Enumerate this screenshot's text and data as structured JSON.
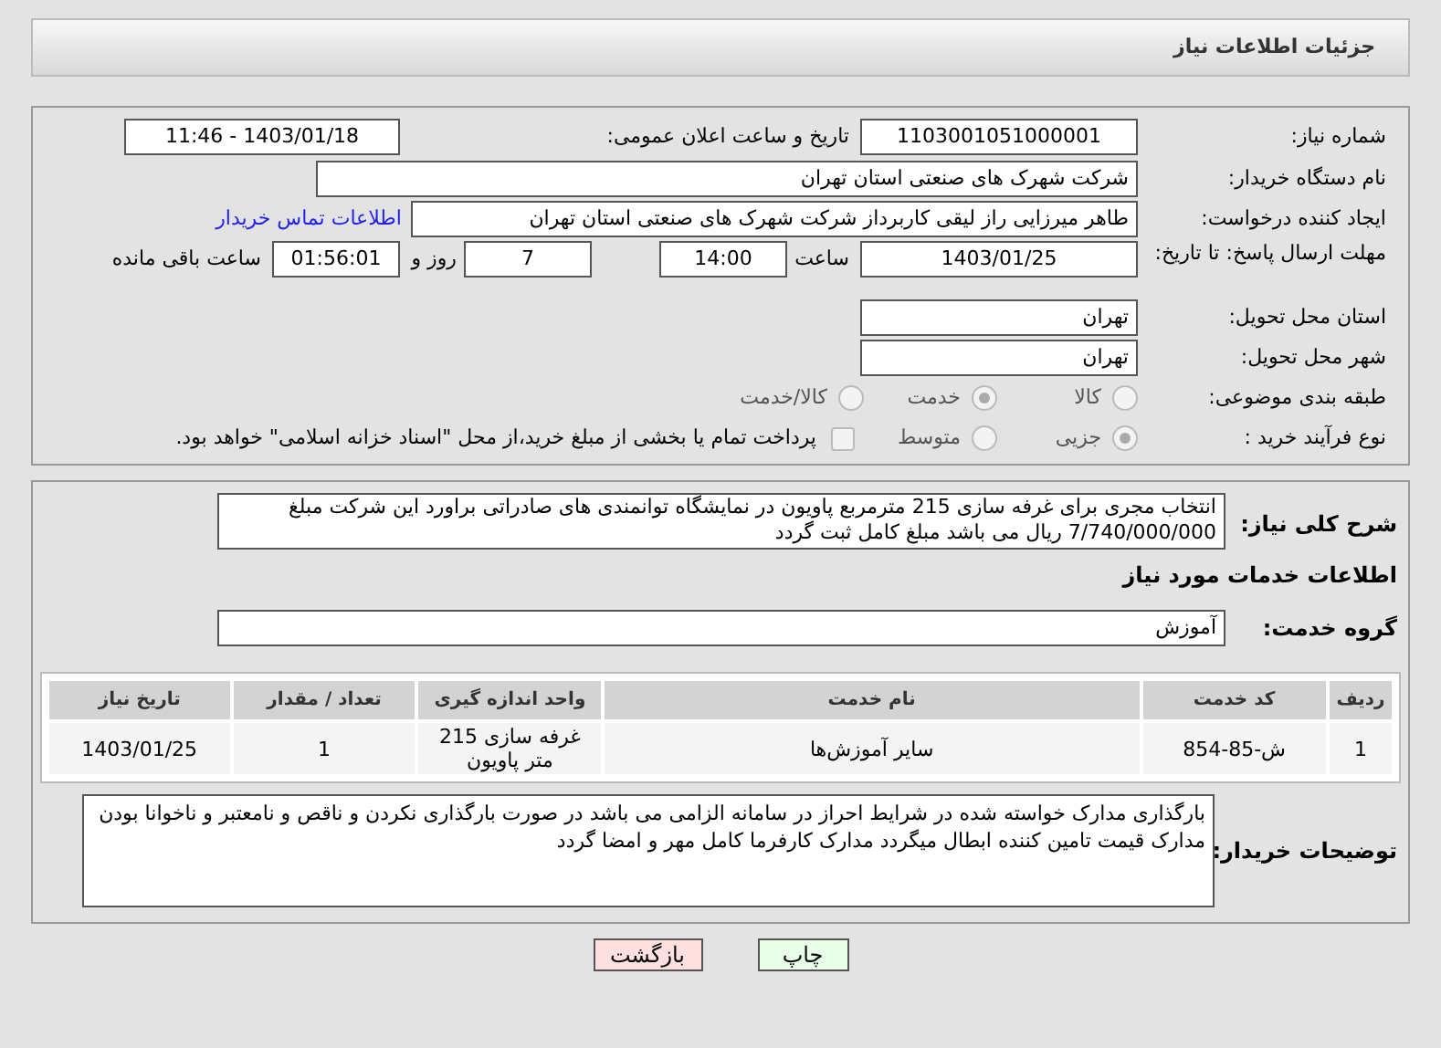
{
  "header": {
    "title": "جزئیات اطلاعات نیاز"
  },
  "need_number": {
    "label": "شماره نیاز:",
    "value": "1103001051000001"
  },
  "announce": {
    "label": "تاریخ و ساعت اعلان عمومی:",
    "value": "1403/01/18 - 11:46"
  },
  "buyer": {
    "label": "نام دستگاه خریدار:",
    "value": "شرکت شهرک های صنعتی استان تهران"
  },
  "requester": {
    "label": "ایجاد کننده درخواست:",
    "value": "طاهر  میرزایی راز لیقی کاربرداز شرکت شهرک های صنعتی استان تهران",
    "link": "اطلاعات تماس خریدار"
  },
  "deadline": {
    "label": "مهلت ارسال پاسخ: تا تاریخ:",
    "date": "1403/01/25",
    "time_label": "ساعت",
    "time": "14:00",
    "days": "7",
    "days_label": "روز و",
    "remaining": "01:56:01",
    "remaining_label": "ساعت باقی مانده"
  },
  "province": {
    "label": "استان محل تحویل:",
    "value": "تهران"
  },
  "city": {
    "label": "شهر محل تحویل:",
    "value": "تهران"
  },
  "category": {
    "label": "طبقه بندی موضوعی:",
    "options": [
      {
        "label": "کالا",
        "selected": false
      },
      {
        "label": "خدمت",
        "selected": true
      },
      {
        "label": "کالا/خدمت",
        "selected": false
      }
    ]
  },
  "process": {
    "label": "نوع فرآیند خرید :",
    "options": [
      {
        "label": "جزیی",
        "selected": true
      },
      {
        "label": "متوسط",
        "selected": false
      }
    ],
    "payment": {
      "checked": false,
      "text": "پرداخت تمام یا بخشی از مبلغ خرید،از محل \"اسناد خزانه اسلامی\" خواهد بود."
    }
  },
  "description": {
    "label": "شرح کلی نیاز:",
    "value": "انتخاب مجری برای غرفه سازی 215 مترمربع پاویون در نمایشگاه توانمندی های صادراتی  براورد این شرکت مبلغ 7/740/000/000 ریال  می باشد  مبلغ  کامل ثبت گردد"
  },
  "services_heading": "اطلاعات خدمات مورد نیاز",
  "service_group": {
    "label": "گروه خدمت:",
    "value": "آموزش"
  },
  "table": {
    "columns": [
      "ردیف",
      "کد خدمت",
      "نام خدمت",
      "واحد اندازه گیری",
      "تعداد / مقدار",
      "تاریخ نیاز"
    ],
    "rows": [
      [
        "1",
        "ش-85-854",
        "سایر آموزش‌ها",
        "غرفه سازی 215 متر پاویون",
        "1",
        "1403/01/25"
      ]
    ]
  },
  "notes": {
    "label": "توضیحات خریدار:",
    "value": "بارگذاری مدارک خواسته شده در شرایط احراز در سامانه الزامی می باشد در صورت بارگذاری نکردن و ناقص و نامعتبر و ناخوانا بودن  مدارک قیمت تامین کننده ابطال  میگردد مدارک کارفرما کامل مهر و امضا گردد"
  },
  "buttons": [
    {
      "label": "چاپ",
      "kind": "print"
    },
    {
      "label": "بازگشت",
      "kind": "back"
    }
  ]
}
